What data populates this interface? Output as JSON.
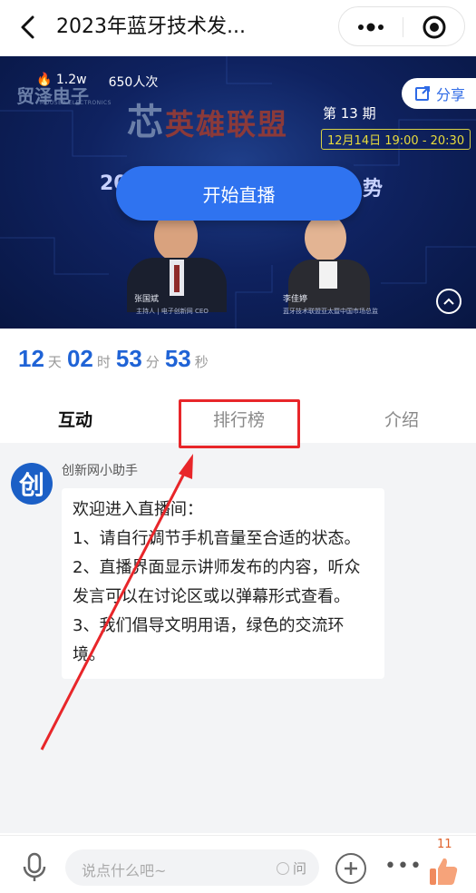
{
  "titlebar": {
    "title": "2023年蓝牙技术发..."
  },
  "banner": {
    "views": "1.2w",
    "participants": "650人次",
    "logo": "贸泽电子",
    "logo_sub": "MOUSER ELECTRONICS",
    "share_label": "分享",
    "event_title": "英雄联盟",
    "event_prefix": "芯",
    "issue": "第 13 期",
    "date": "12月14日 19:00 - 20:30",
    "row_left": "20",
    "row_right": "势",
    "start_label": "开始直播",
    "host1_name": "张国斌",
    "host1_role": "主持人 | 电子创新网 CEO",
    "host2_name": "李佳婷",
    "host2_role": "蓝牙技术联盟亚太暨中国市场总监"
  },
  "countdown": {
    "days": "12",
    "days_unit": "天",
    "hours": "02",
    "hours_unit": "时",
    "minutes": "53",
    "minutes_unit": "分",
    "seconds": "53",
    "seconds_unit": "秒"
  },
  "tabs": [
    {
      "label": "互动"
    },
    {
      "label": "排行榜"
    },
    {
      "label": "介绍"
    }
  ],
  "chat": {
    "avatar_char": "创",
    "sender": "创新网小助手",
    "lines": [
      "欢迎进入直播间：",
      "1、请自行调节手机音量至合适的状态。",
      "2、直播界面显示讲师发布的内容，听众发言可以在讨论区或以弹幕形式查看。",
      "3、我们倡导文明用语，绿色的交流环境。"
    ]
  },
  "bottombar": {
    "placeholder": "说点什么吧~",
    "ask_label": "问",
    "like_count": "11"
  },
  "colors": {
    "accent": "#2f73f0",
    "countdown": "#1f63d6",
    "annotation": "#e8262a"
  }
}
